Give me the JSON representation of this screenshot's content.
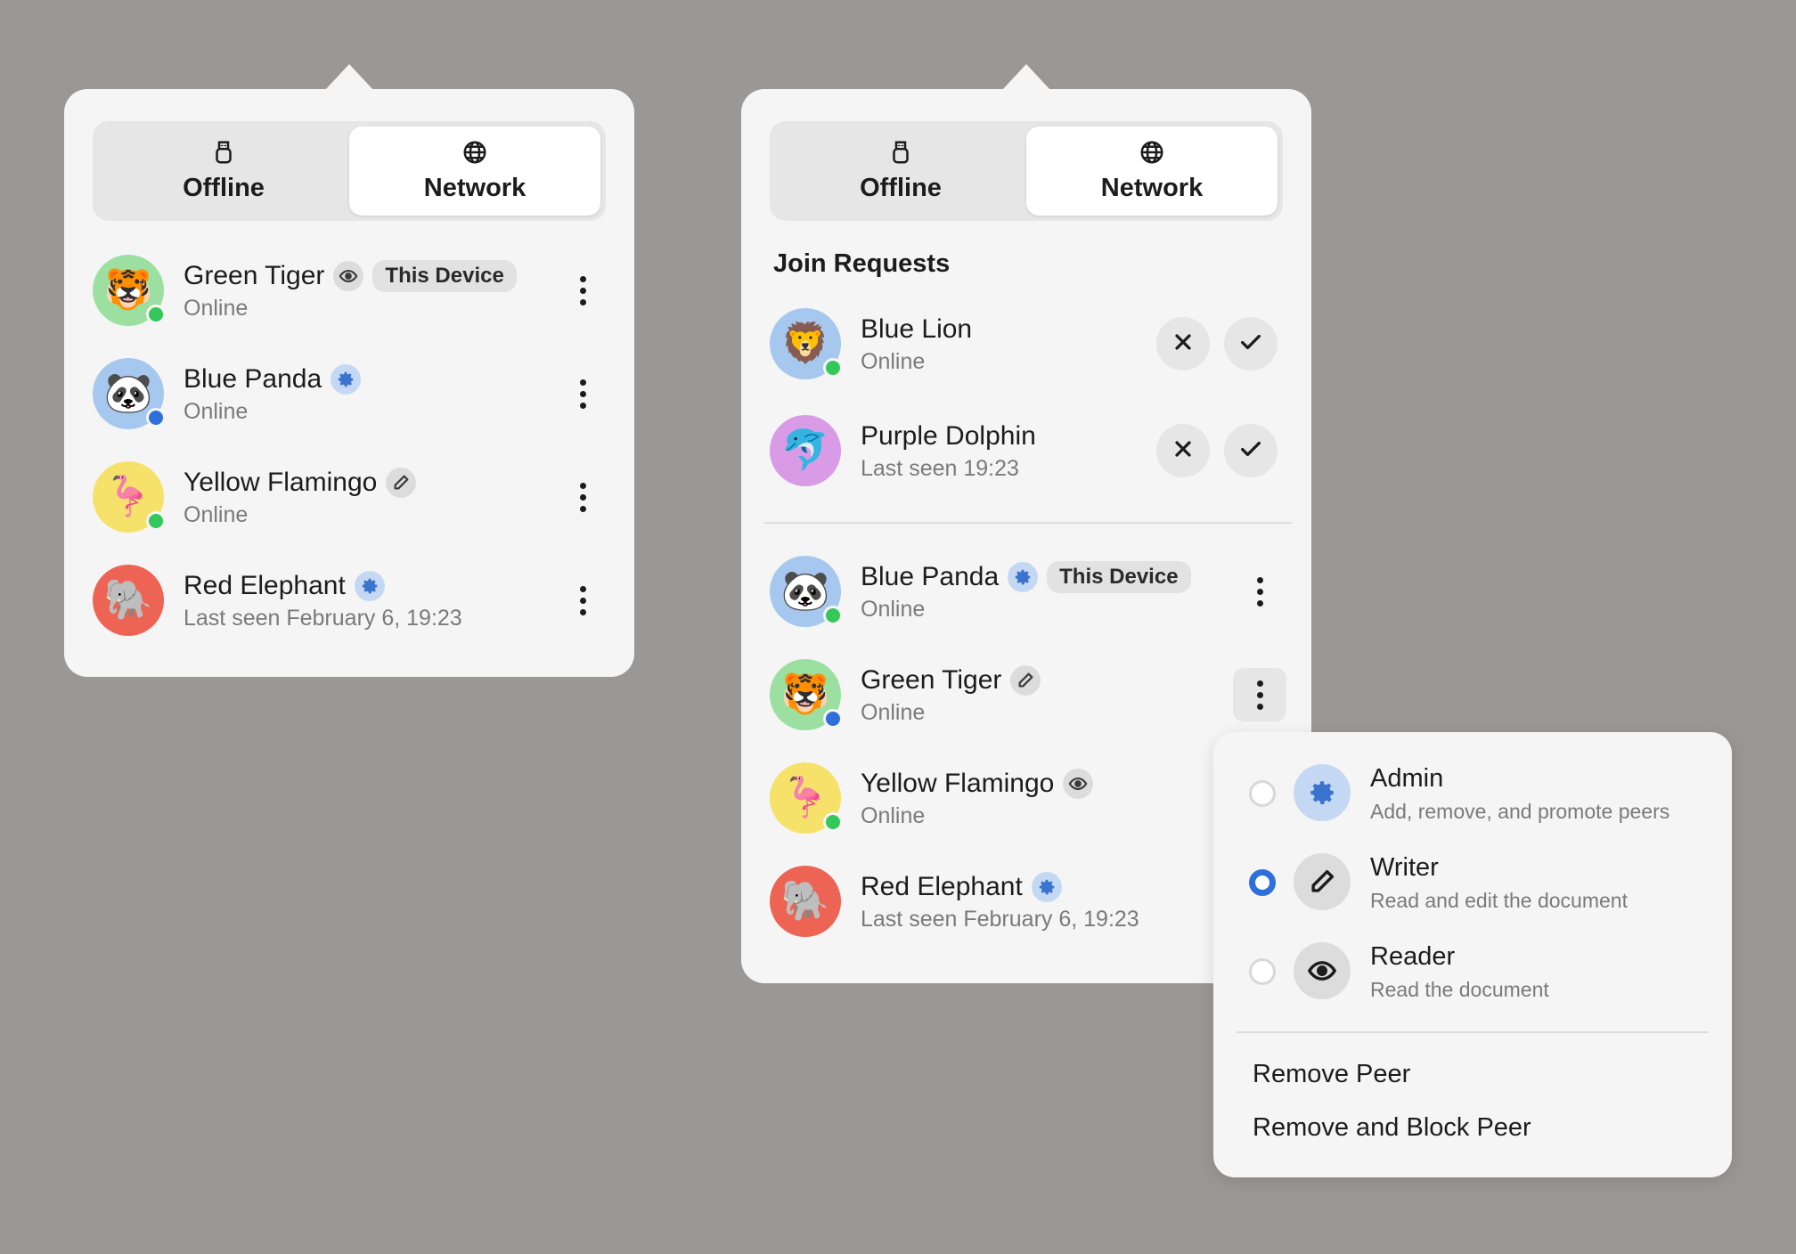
{
  "tabs": {
    "offline": "Offline",
    "network": "Network",
    "active": "network"
  },
  "colors": {
    "online_dot": "#34c759",
    "admin_dot": "#2f6fdb",
    "admin_icon_bg": "#c5d8f3",
    "admin_icon": "#3a74cf",
    "neutral_icon_bg": "#dcdcdc",
    "radio_selected": "#2f6fdb"
  },
  "panel1": {
    "peers": [
      {
        "name": "Green Tiger",
        "status": "Online",
        "emoji": "🐯",
        "avatar_bg": "#9be0a0",
        "dot": "#34c759",
        "role_icon": "eye-icon",
        "badge": "This Device"
      },
      {
        "name": "Blue Panda",
        "status": "Online",
        "emoji": "🐼",
        "avatar_bg": "#a6c7ee",
        "dot": "#2f6fdb",
        "role_icon": "gear-icon",
        "badge": ""
      },
      {
        "name": "Yellow Flamingo",
        "status": "Online",
        "emoji": "🦩",
        "avatar_bg": "#f6e26b",
        "dot": "#34c759",
        "role_icon": "pencil-icon",
        "badge": ""
      },
      {
        "name": "Red Elephant",
        "status": "Last seen February 6, 19:23",
        "emoji": "🐘",
        "avatar_bg": "#ee6454",
        "dot": "",
        "role_icon": "gear-icon",
        "badge": ""
      }
    ]
  },
  "panel2": {
    "join_title": "Join Requests",
    "requests": [
      {
        "name": "Blue Lion",
        "status": "Online",
        "emoji": "🦁",
        "avatar_bg": "#a6c7ee",
        "dot": "#34c759"
      },
      {
        "name": "Purple Dolphin",
        "status": "Last seen 19:23",
        "emoji": "🐬",
        "avatar_bg": "#d99be6",
        "dot": ""
      }
    ],
    "peers": [
      {
        "name": "Blue Panda",
        "status": "Online",
        "emoji": "🐼",
        "avatar_bg": "#a6c7ee",
        "dot": "#34c759",
        "role_icon": "gear-icon",
        "badge": "This Device"
      },
      {
        "name": "Green Tiger",
        "status": "Online",
        "emoji": "🐯",
        "avatar_bg": "#9be0a0",
        "dot": "#2f6fdb",
        "role_icon": "pencil-icon",
        "badge": ""
      },
      {
        "name": "Yellow Flamingo",
        "status": "Online",
        "emoji": "🦩",
        "avatar_bg": "#f6e26b",
        "dot": "#34c759",
        "role_icon": "eye-icon",
        "badge": ""
      },
      {
        "name": "Red Elephant",
        "status": "Last seen February 6, 19:23",
        "emoji": "🐘",
        "avatar_bg": "#ee6454",
        "dot": "",
        "role_icon": "gear-icon",
        "badge": ""
      }
    ]
  },
  "role_menu": {
    "options": [
      {
        "title": "Admin",
        "desc": "Add, remove, and promote peers",
        "icon": "gear-icon",
        "selected": false
      },
      {
        "title": "Writer",
        "desc": "Read and edit the document",
        "icon": "pencil-icon",
        "selected": true
      },
      {
        "title": "Reader",
        "desc": "Read the document",
        "icon": "eye-icon",
        "selected": false
      }
    ],
    "remove_peer": "Remove Peer",
    "remove_block_peer": "Remove and Block Peer"
  }
}
